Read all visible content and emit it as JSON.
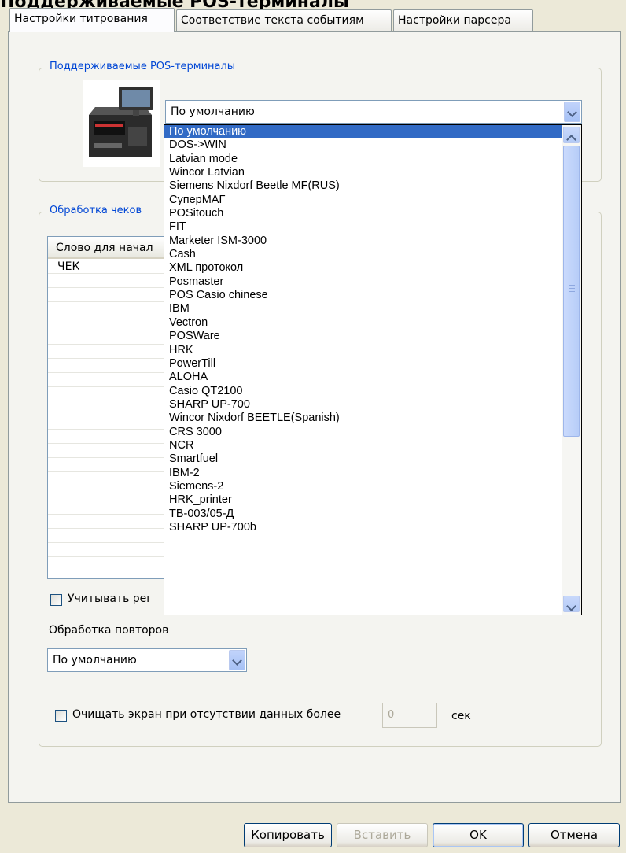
{
  "header_partial": "Поддерживаемые POS-терминалы",
  "tabs": [
    {
      "label": "Настройки титрования"
    },
    {
      "label": "Соответствие текста событиям"
    },
    {
      "label": "Настройки парсера"
    }
  ],
  "pos_group": {
    "legend": "Поддерживаемые POS-терминалы",
    "combo_value": "По умолчанию"
  },
  "dropdown_items": [
    "По умолчанию",
    "DOS->WIN",
    "Latvian mode",
    "Wincor Latvian",
    "Siemens Nixdorf Beetle MF(RUS)",
    "СуперМАГ",
    "POSitouch",
    "FIT",
    "Marketer ISM-3000",
    "Cash",
    "XML протокол",
    "Posmaster",
    "POS Casio chinese",
    "IBM",
    "Vectron",
    "POSWare",
    "HRK",
    "PowerTill",
    "ALOHA",
    "Casio QT2100",
    "SHARP UP-700",
    "Wincor Nixdorf BEETLE(Spanish)",
    "CRS 3000",
    "NCR",
    "Smartfuel",
    "IBM-2",
    "Siemens-2",
    "HRK_printer",
    "ТВ-003/05-Д",
    "SHARP UP-700b"
  ],
  "selected_index": 0,
  "checks_group": {
    "legend": "Обработка чеков",
    "table_header": "Слово для начал",
    "table_rows": [
      "ЧЕК"
    ],
    "case_checkbox_label": "Учитывать рег",
    "repeats_label": "Обработка повторов",
    "repeats_value": "По умолчанию",
    "clear_checkbox_label": "Очищать экран при отсутствии данных более",
    "clear_value": "0",
    "clear_unit": "сек"
  },
  "buttons": {
    "copy": "Копировать",
    "paste": "Вставить",
    "ok": "OK",
    "cancel": "Отмена"
  },
  "colors": {
    "selection": "#316ac5",
    "legend": "#0046d5"
  }
}
